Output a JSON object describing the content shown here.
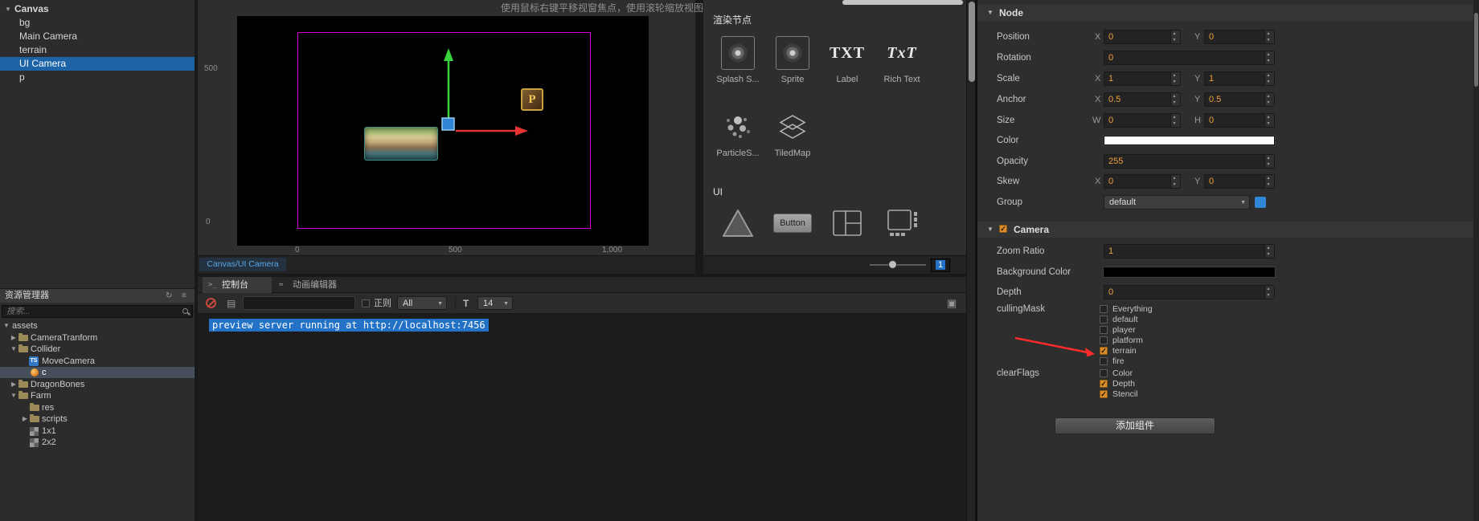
{
  "colors": {
    "accent_orange": "#f0a13c",
    "selection_blue": "#1d63a8",
    "log_highlight_blue": "#2472c8",
    "gizmo_green": "#39d23c",
    "gizmo_red": "#e53232",
    "gizmo_blue": "#2e86d4",
    "design_border_magenta": "#d400d4",
    "annotation_red": "#ff2b2b"
  },
  "hierarchy": {
    "items": [
      {
        "label": "Canvas",
        "selected": false
      },
      {
        "label": "bg",
        "selected": false
      },
      {
        "label": "Main Camera",
        "selected": false
      },
      {
        "label": "terrain",
        "selected": false
      },
      {
        "label": "UI Camera",
        "selected": true
      },
      {
        "label": "p",
        "selected": false
      }
    ]
  },
  "assets_panel": {
    "title": "资源管理器",
    "search_placeholder": "搜索...",
    "items": [
      {
        "label": "assets",
        "selected": false
      },
      {
        "label": "CameraTranform",
        "selected": false
      },
      {
        "label": "Collider",
        "selected": false
      },
      {
        "label": "MoveCamera",
        "icon_text": "TS",
        "selected": false
      },
      {
        "label": "c",
        "selected": true
      },
      {
        "label": "DragonBones",
        "selected": false
      },
      {
        "label": "Farm",
        "selected": false
      },
      {
        "label": "res",
        "selected": false
      },
      {
        "label": "scripts",
        "selected": false
      },
      {
        "label": "1x1",
        "selected": false
      },
      {
        "label": "2x2",
        "selected": false
      }
    ]
  },
  "scene": {
    "hint": "使用鼠标右键平移视窗焦点，使用滚轮缩放视图",
    "ruler_left_top": "500",
    "ruler_left_bottom": "0",
    "ruler_bottom": [
      "0",
      "500",
      "1,000"
    ],
    "p_sprite_label": "P",
    "bottom_tab": "Canvas/UI Camera"
  },
  "render_panel": {
    "title": "渲染节点",
    "items": [
      {
        "label": "Splash S..."
      },
      {
        "label": "Sprite"
      },
      {
        "label": "Label",
        "glyph": "TXT"
      },
      {
        "label": "Rich Text",
        "glyph": "TxT"
      },
      {
        "label": "ParticleS..."
      },
      {
        "label": "TiledMap"
      }
    ],
    "ui_section_title": "UI",
    "button_widget_label": "Button",
    "zoom_value": "1"
  },
  "console": {
    "tab_console": "控制台",
    "tab_animation": "动画编辑器",
    "regex_label": "正则",
    "level_filter": "All",
    "font_tool_label": "T",
    "font_size": "14",
    "log_line": "preview server running at http://localhost:7456"
  },
  "inspector": {
    "node": {
      "title": "Node",
      "position": {
        "label": "Position",
        "x_label": "X",
        "x": "0",
        "y_label": "Y",
        "y": "0"
      },
      "rotation": {
        "label": "Rotation",
        "value": "0"
      },
      "scale": {
        "label": "Scale",
        "x_label": "X",
        "x": "1",
        "y_label": "Y",
        "y": "1"
      },
      "anchor": {
        "label": "Anchor",
        "x_label": "X",
        "x": "0.5",
        "y_label": "Y",
        "y": "0.5"
      },
      "size": {
        "label": "Size",
        "x_label": "W",
        "x": "0",
        "y_label": "H",
        "y": "0"
      },
      "color": {
        "label": "Color",
        "value": "#ffffff"
      },
      "opacity": {
        "label": "Opacity",
        "value": "255"
      },
      "skew": {
        "label": "Skew",
        "x_label": "X",
        "x": "0",
        "y_label": "Y",
        "y": "0"
      },
      "group": {
        "label": "Group",
        "value": "default"
      }
    },
    "camera": {
      "title": "Camera",
      "enabled": true,
      "zoom_ratio": {
        "label": "Zoom Ratio",
        "value": "1"
      },
      "background_color": {
        "label": "Background Color",
        "value": "#000000"
      },
      "depth": {
        "label": "Depth",
        "value": "0"
      },
      "culling_mask": {
        "label": "cullingMask",
        "options": [
          {
            "label": "Everything",
            "checked": false
          },
          {
            "label": "default",
            "checked": false
          },
          {
            "label": "player",
            "checked": false
          },
          {
            "label": "platform",
            "checked": false
          },
          {
            "label": "terrain",
            "checked": true
          },
          {
            "label": "fire",
            "checked": false
          }
        ]
      },
      "clear_flags": {
        "label": "clearFlags",
        "options": [
          {
            "label": "Color",
            "checked": false
          },
          {
            "label": "Depth",
            "checked": true
          },
          {
            "label": "Stencil",
            "checked": true
          }
        ]
      }
    },
    "add_component_label": "添加组件"
  }
}
